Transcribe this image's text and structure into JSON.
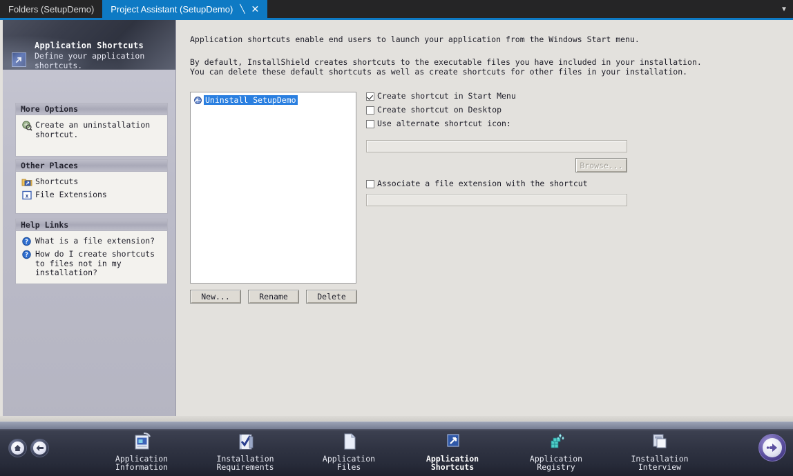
{
  "window": {
    "tabs": [
      {
        "label": "Folders (SetupDemo)",
        "active": false
      },
      {
        "label": "Project Assistant (SetupDemo)",
        "active": true
      }
    ],
    "tab_pin_icon": "pin-icon",
    "tab_close_icon": "close-icon",
    "tab_overflow_icon": "chevron-down-icon"
  },
  "banner": {
    "icon": "shortcut-arrow-icon",
    "title": "Application Shortcuts",
    "subtitle": "Define your application shortcuts."
  },
  "sidebar": {
    "panels": [
      {
        "id": "more-options",
        "title": "More Options",
        "items": [
          {
            "icon": "uninstall-shortcut-icon",
            "label": "Create an uninstallation shortcut."
          }
        ]
      },
      {
        "id": "other-places",
        "title": "Other Places",
        "items": [
          {
            "icon": "folder-shortcut-icon",
            "label": "Shortcuts"
          },
          {
            "icon": "file-extension-icon",
            "label": "File Extensions"
          }
        ]
      },
      {
        "id": "help-links",
        "title": "Help Links",
        "items": [
          {
            "icon": "help-question-icon",
            "label": "What is a file extension?"
          },
          {
            "icon": "help-question-icon",
            "label": "How do I create shortcuts to files not in my installation?"
          }
        ]
      }
    ]
  },
  "main": {
    "intro_paragraph_1": "Application shortcuts enable end users to launch your application from the Windows Start menu.",
    "intro_paragraph_2_line1": "By default, InstallShield creates shortcuts to the executable files you have included in your installation.",
    "intro_paragraph_2_line2": "You can delete these default shortcuts as well as create shortcuts for other files in your installation.",
    "shortcut_list": [
      {
        "icon": "shortcut-item-icon",
        "label": "Uninstall SetupDemo",
        "selected": true
      }
    ],
    "list_buttons": [
      {
        "label": "New...",
        "disabled": false
      },
      {
        "label": "Rename",
        "disabled": false
      },
      {
        "label": "Delete",
        "disabled": false
      }
    ],
    "options": {
      "start_menu": {
        "label": "Create shortcut in Start Menu",
        "checked": true
      },
      "desktop": {
        "label": "Create shortcut on Desktop",
        "checked": false
      },
      "alternate_icon": {
        "label": "Use alternate shortcut icon:",
        "checked": false
      },
      "icon_field_value": "",
      "browse_button": {
        "label": "Browse...",
        "disabled": true
      },
      "associate_extension": {
        "label": "Associate a file extension with the shortcut",
        "checked": false
      },
      "extension_field_value": ""
    }
  },
  "navigation": {
    "home_button": {
      "name": "home-button",
      "icon": "home-icon"
    },
    "back_button": {
      "name": "back-button",
      "icon": "arrow-left-icon"
    },
    "next_button": {
      "name": "next-button",
      "icon": "arrow-right-icon"
    },
    "steps": [
      {
        "icon": "application-information-icon",
        "line1": "Application",
        "line2": "Information",
        "active": false
      },
      {
        "icon": "installation-requirements-icon",
        "line1": "Installation",
        "line2": "Requirements",
        "active": false
      },
      {
        "icon": "application-files-icon",
        "line1": "Application",
        "line2": "Files",
        "active": false
      },
      {
        "icon": "application-shortcuts-icon",
        "line1": "Application",
        "line2": "Shortcuts",
        "active": true
      },
      {
        "icon": "application-registry-icon",
        "line1": "Application",
        "line2": "Registry",
        "active": false
      },
      {
        "icon": "installation-interview-icon",
        "line1": "Installation",
        "line2": "Interview",
        "active": false
      }
    ]
  },
  "colors": {
    "accent_blue": "#0e7ac4",
    "selection_blue": "#2a7fe0",
    "sidebar_bg": "#bcbcc9",
    "content_bg": "#e3e1dd",
    "navbar_dark": "#2f3342"
  }
}
